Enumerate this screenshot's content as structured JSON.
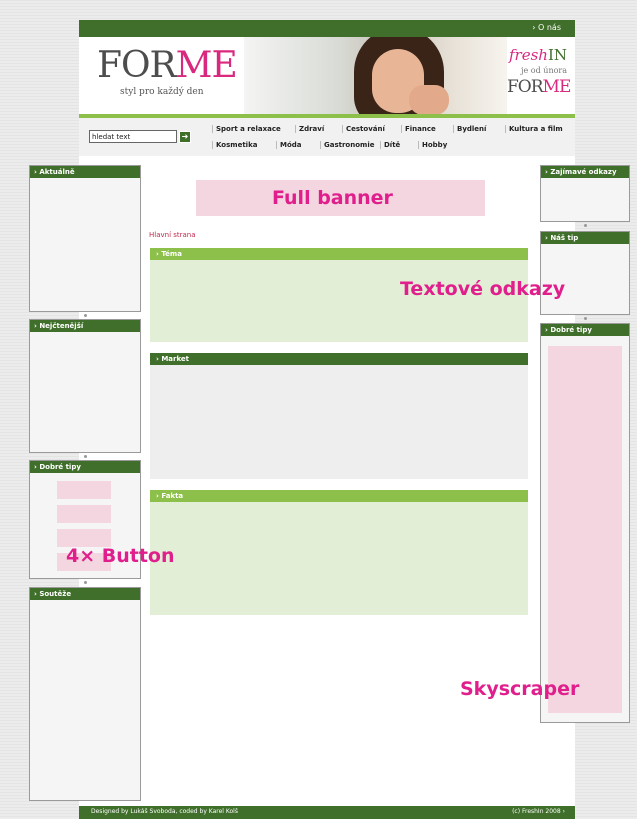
{
  "topbar": {
    "link": "› O nás"
  },
  "header": {
    "logo_part1": "FOR",
    "logo_part2": "ME",
    "tagline": "styl pro každý den",
    "promo": {
      "fresh": "fresh",
      "in": "IN",
      "sub": "je od února",
      "forme1": "FOR",
      "forme2": "ME"
    }
  },
  "search": {
    "value": "hledat text"
  },
  "nav": {
    "row1": [
      "Sport a relaxace",
      "Zdraví",
      "Cestování",
      "Finance",
      "Bydlení",
      "Kultura a film"
    ],
    "row2": [
      "Kosmetika",
      "Móda",
      "Gastronomie",
      "Dítě",
      "Hobby"
    ]
  },
  "left_boxes": [
    {
      "title": "› Aktuálně"
    },
    {
      "title": "› Nejčtenější"
    },
    {
      "title": "› Dobré tipy"
    },
    {
      "title": "› Soutěže"
    }
  ],
  "right_boxes": [
    {
      "title": "› Zajímavé odkazy"
    },
    {
      "title": "› Náš tip"
    },
    {
      "title": "› Dobré tipy"
    }
  ],
  "main": {
    "banner_label": "Full banner",
    "breadcrumb": "Hlavní strana",
    "sections": [
      {
        "title": "› Téma"
      },
      {
        "title": "› Market"
      },
      {
        "title": "› Fakta"
      }
    ],
    "links_label": "Textové odkazy"
  },
  "placeholders": {
    "buttons_label": "4× Button",
    "skyscraper_label": "Skyscraper"
  },
  "footer": {
    "left": "Designed by Lukáš Svoboda, coded by Karel Kolš",
    "right": "(c) FreshIn 2008 ›"
  },
  "colors": {
    "dark_green": "#3f6f2a",
    "light_green": "#8dc04a",
    "pink": "#d8297f",
    "placeholder_pink": "#f4d6e0",
    "overlay_magenta": "#e01e8c"
  }
}
